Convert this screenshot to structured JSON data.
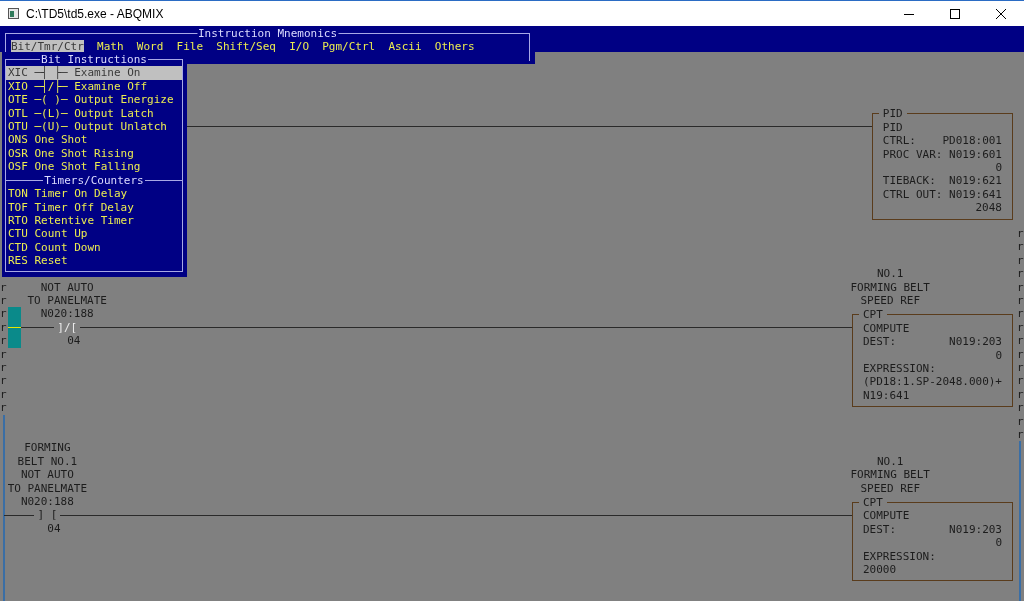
{
  "window": {
    "title": "C:\\TD5\\td5.exe - ABQMIX"
  },
  "mnemonics_menu": {
    "title": "Instruction Mnemonics",
    "items": [
      {
        "label": "Bit/Tmr/Ctr",
        "selected": true
      },
      {
        "label": "Math",
        "selected": false
      },
      {
        "label": "Word",
        "selected": false
      },
      {
        "label": "File",
        "selected": false
      },
      {
        "label": "Shift/Seq",
        "selected": false
      },
      {
        "label": "I/O",
        "selected": false
      },
      {
        "label": "Pgm/Ctrl",
        "selected": false
      },
      {
        "label": "Ascii",
        "selected": false
      },
      {
        "label": "Others",
        "selected": false
      }
    ]
  },
  "instruction_dropdown": {
    "sections": [
      {
        "title": "Bit Instructions",
        "items": [
          {
            "mnemonic": "XIC",
            "symbol": "─┤ ├─",
            "description": "Examine On",
            "selected": true
          },
          {
            "mnemonic": "XIO",
            "symbol": "─┤/├─",
            "description": "Examine Off",
            "selected": false
          },
          {
            "mnemonic": "OTE",
            "symbol": "─( )─",
            "description": "Output Energize",
            "selected": false
          },
          {
            "mnemonic": "OTL",
            "symbol": "─(L)─",
            "description": "Output Latch",
            "selected": false
          },
          {
            "mnemonic": "OTU",
            "symbol": "─(U)─",
            "description": "Output Unlatch",
            "selected": false
          },
          {
            "mnemonic": "ONS",
            "description": "One Shot",
            "selected": false
          },
          {
            "mnemonic": "OSR",
            "description": "One Shot Rising",
            "selected": false
          },
          {
            "mnemonic": "OSF",
            "description": "One Shot Falling",
            "selected": false
          }
        ]
      },
      {
        "title": "Timers/Counters",
        "items": [
          {
            "mnemonic": "TON",
            "description": "Timer On Delay",
            "selected": false
          },
          {
            "mnemonic": "TOF",
            "description": "Timer Off Delay",
            "selected": false
          },
          {
            "mnemonic": "RTO",
            "description": "Retentive Timer",
            "selected": false
          },
          {
            "mnemonic": "CTU",
            "description": "Count Up",
            "selected": false
          },
          {
            "mnemonic": "CTD",
            "description": "Count Down",
            "selected": false
          },
          {
            "mnemonic": "RES",
            "description": "Reset",
            "selected": false
          }
        ]
      }
    ]
  },
  "ladder": {
    "left_rail_marks": [
      "r",
      "r",
      "r",
      "r",
      "r",
      "r",
      "r",
      "r",
      "r",
      "r"
    ],
    "right_rail_marks": [
      "r",
      "r",
      "r",
      "r",
      "r",
      "r",
      "r",
      "r",
      "r",
      "r",
      "r",
      "r",
      "r",
      "r",
      "r",
      "r"
    ],
    "rungs": [
      {
        "cursor": false,
        "output": {
          "box": {
            "title": "PID",
            "lines": [
              {
                "kind": "text",
                "text": "PID"
              },
              {
                "kind": "field",
                "label": "CTRL:",
                "value": "PD018:001"
              },
              {
                "kind": "field",
                "label": "PROC VAR:",
                "value": "N019:601"
              },
              {
                "kind": "value",
                "text": "0"
              },
              {
                "kind": "field",
                "label": "TIEBACK:",
                "value": "N019:621"
              },
              {
                "kind": "field",
                "label": "CTRL OUT:",
                "value": "N019:641"
              },
              {
                "kind": "value",
                "text": "2048"
              }
            ]
          }
        }
      },
      {
        "cursor": true,
        "contact": {
          "comments": [
            "NOT AUTO",
            "TO PANELMATE"
          ],
          "address": "N020:188",
          "symbol": "]/[",
          "bit": "04",
          "energized": true
        },
        "output": {
          "comments": [
            "NO.1",
            "FORMING BELT",
            "SPEED REF"
          ],
          "box": {
            "title": "CPT",
            "lines": [
              {
                "kind": "text",
                "text": "COMPUTE"
              },
              {
                "kind": "field",
                "label": "DEST:",
                "value": "N019:203"
              },
              {
                "kind": "value",
                "text": "0"
              },
              {
                "kind": "text",
                "text": "EXPRESSION:"
              },
              {
                "kind": "text",
                "text": "(PD18:1.SP-2048.000)+"
              },
              {
                "kind": "text",
                "text": "N19:641"
              }
            ]
          }
        }
      },
      {
        "cursor": false,
        "contact": {
          "comments": [
            "FORMING",
            "BELT NO.1",
            "NOT AUTO",
            "TO PANELMATE"
          ],
          "address": "N020:188",
          "symbol": "] [",
          "bit": "04",
          "energized": false
        },
        "output": {
          "comments": [
            "NO.1",
            "FORMING BELT",
            "SPEED REF"
          ],
          "box": {
            "title": "CPT",
            "lines": [
              {
                "kind": "text",
                "text": "COMPUTE"
              },
              {
                "kind": "field",
                "label": "DEST:",
                "value": "N019:203"
              },
              {
                "kind": "value",
                "text": "0"
              },
              {
                "kind": "text",
                "text": "EXPRESSION:"
              },
              {
                "kind": "text",
                "text": "20000"
              }
            ]
          }
        }
      }
    ]
  }
}
